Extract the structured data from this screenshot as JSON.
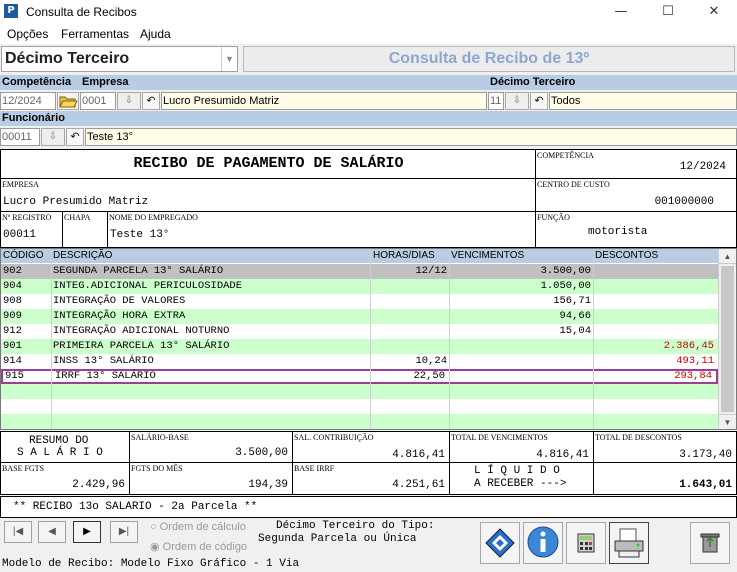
{
  "window": {
    "title": "Consulta de Recibos",
    "app_icon_letter": "P",
    "minimize": "—",
    "maximize": "☐",
    "close": "✕"
  },
  "menu": [
    "Opções",
    "Ferramentas",
    "Ajuda"
  ],
  "type_select": {
    "value": "Décimo Terceiro"
  },
  "heading": "Consulta de Recibo de 13º",
  "filters": {
    "competencia_label": "Competência",
    "competencia_value": "12/2024",
    "empresa_label": "Empresa",
    "empresa_code": "0001",
    "empresa_name": "Lucro Presumido Matriz",
    "decimo_label": "Décimo Terceiro",
    "decimo_code": "11",
    "decimo_name": "Todos",
    "funcionario_label": "Funcionário",
    "funcionario_code": "00011",
    "funcionario_name": "Teste 13°"
  },
  "receipt": {
    "title": "RECIBO DE PAGAMENTO DE SALÁRIO",
    "competencia_lbl": "COMPETÊNCIA",
    "competencia": "12/2024",
    "empresa_lbl": "EMPRESA",
    "empresa": "Lucro Presumido Matriz",
    "centro_lbl": "CENTRO DE CUSTO",
    "centro": "001000000",
    "registro_lbl": "Nº REGISTRO",
    "registro": "00011",
    "chapa_lbl": "CHAPA",
    "nome_lbl": "NOME DO EMPREGADO",
    "nome": "Teste 13°",
    "funcao_lbl": "FUNÇÃO",
    "funcao": "motorista"
  },
  "grid": {
    "headers": [
      "CÓDIGO",
      "DESCRIÇÃO",
      "HORAS/DIAS",
      "VENCIMENTOS",
      "DESCONTOS"
    ],
    "rows": [
      {
        "code": "902",
        "desc": "SEGUNDA PARCELA 13° SALÁRIO",
        "hours": "12/12",
        "venc": "3.500,00",
        "desc_val": ""
      },
      {
        "code": "904",
        "desc": "INTEG.ADICIONAL PERICULOSIDADE",
        "hours": "",
        "venc": "1.050,00",
        "desc_val": ""
      },
      {
        "code": "908",
        "desc": "INTEGRAÇÃO DE VALORES",
        "hours": "",
        "venc": "156,71",
        "desc_val": ""
      },
      {
        "code": "909",
        "desc": "INTEGRAÇÃO HORA EXTRA",
        "hours": "",
        "venc": "94,66",
        "desc_val": ""
      },
      {
        "code": "912",
        "desc": "INTEGRAÇÃO ADICIONAL NOTURNO",
        "hours": "",
        "venc": "15,04",
        "desc_val": ""
      },
      {
        "code": "901",
        "desc": "PRIMEIRA PARCELA 13° SALÁRIO",
        "hours": "",
        "venc": "",
        "desc_val": "2.386,45"
      },
      {
        "code": "914",
        "desc": "INSS 13° SALÁRIO",
        "hours": "10,24",
        "venc": "",
        "desc_val": "493,11"
      },
      {
        "code": "915",
        "desc": "IRRF 13° SALÁRIO",
        "hours": "22,50",
        "venc": "",
        "desc_val": "293,84"
      }
    ]
  },
  "summary": {
    "resumo_line1": "RESUMO DO",
    "resumo_line2": "S A L Á R I O",
    "salario_base_lbl": "SALÁRIO-BASE",
    "salario_base": "3.500,00",
    "sal_contrib_lbl": "SAL. CONTRIBUIÇÃO",
    "sal_contrib": "4.816,41",
    "total_venc_lbl": "TOTAL DE VENCIMENTOS",
    "total_venc": "4.816,41",
    "total_desc_lbl": "TOTAL DE DESCONTOS",
    "total_desc": "3.173,40",
    "base_fgts_lbl": "BASE FGTS",
    "base_fgts": "2.429,96",
    "fgts_mes_lbl": "FGTS DO MÊS",
    "fgts_mes": "194,39",
    "base_irrf_lbl": "BASE IRRF",
    "base_irrf": "4.251,61",
    "liquido_line1": "L Í Q U I D O",
    "liquido_line2": "A RECEBER --->",
    "liquido": "1.643,01"
  },
  "info_text": "** RECIBO 13o SALARIO - 2a Parcela **",
  "nav": {
    "first": "|◀",
    "prev": "◀",
    "next": "▶",
    "last": "▶|"
  },
  "sort": {
    "calc": "Ordem de cálculo",
    "code": "Ordem de código"
  },
  "tipo_line1": "Décimo Terceiro do Tipo:",
  "tipo_line2": "Segunda Parcela ou Única",
  "footer": "Modelo de Recibo: Modelo Fixo Gráfico - 1 Via",
  "icons": {
    "nav": "diamond-nav-icon",
    "info": "info-icon",
    "calc": "calculator-icon",
    "print": "printer-icon",
    "trash": "recycle-bin-icon"
  },
  "colors": {
    "row_green": "#ccffcc",
    "row_gray": "#c0c0c0",
    "header_blue": "#b8cce4",
    "highlight": "#9b3d9b",
    "discount_red": "#cc0000"
  }
}
